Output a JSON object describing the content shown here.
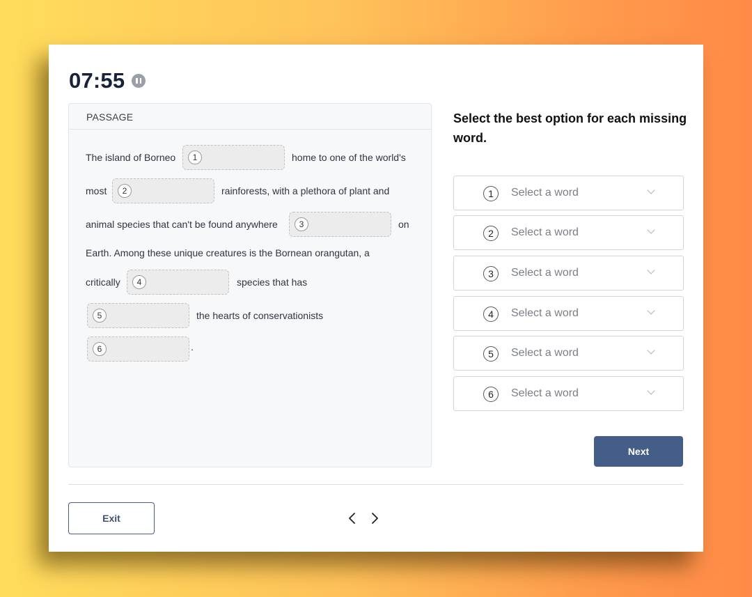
{
  "timer": {
    "value": "07:55"
  },
  "passage": {
    "header": "PASSAGE",
    "text": [
      "The island of Borneo",
      "home to one of the world's",
      "most",
      "rainforests, with a plethora of plant and",
      "animal species that can't be found anywhere",
      "on",
      "Earth. Among these unique creatures is the Bornean orangutan, a",
      "critically",
      "species that has",
      "the hearts of conservationists",
      "."
    ],
    "blanks": [
      "1",
      "2",
      "3",
      "4",
      "5",
      "6"
    ]
  },
  "question": "Select the best option for each missing word.",
  "selects": [
    {
      "number": "1",
      "placeholder": "Select a word"
    },
    {
      "number": "2",
      "placeholder": "Select a word"
    },
    {
      "number": "3",
      "placeholder": "Select a word"
    },
    {
      "number": "4",
      "placeholder": "Select a word"
    },
    {
      "number": "5",
      "placeholder": "Select a word"
    },
    {
      "number": "6",
      "placeholder": "Select a word"
    }
  ],
  "buttons": {
    "next": "Next",
    "exit": "Exit"
  },
  "icons": {
    "pause": "pause-icon",
    "chevron": "chevron-down-icon",
    "prev": "chevron-left-icon",
    "next": "chevron-right-icon"
  },
  "colors": {
    "primary": "#445e87",
    "timer_text": "#16233a",
    "blank_bg": "#ececec"
  }
}
